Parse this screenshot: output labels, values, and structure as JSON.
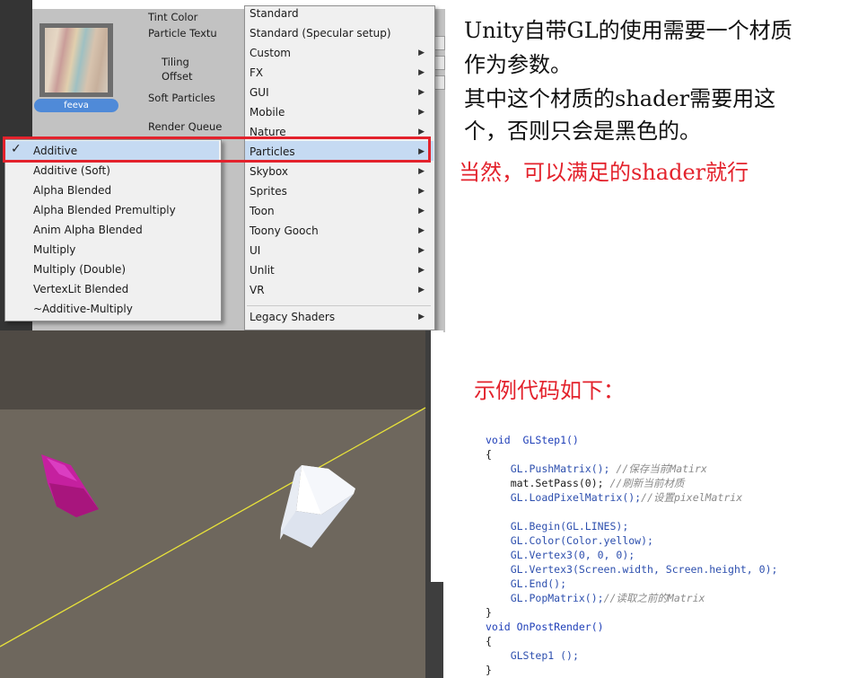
{
  "inspector": {
    "material_name": "feeva",
    "labels": {
      "tint_color": "Tint Color",
      "particle_texture": "Particle Textu",
      "tiling": "Tiling",
      "offset": "Offset",
      "soft_particles": "Soft Particles",
      "render_queue": "Render Queue"
    }
  },
  "shader_menu": {
    "items": [
      {
        "label": "Standard",
        "submenu": false
      },
      {
        "label": "Standard (Specular setup)",
        "submenu": false
      },
      {
        "label": "Custom",
        "submenu": true
      },
      {
        "label": "FX",
        "submenu": true
      },
      {
        "label": "GUI",
        "submenu": true
      },
      {
        "label": "Mobile",
        "submenu": true
      },
      {
        "label": "Nature",
        "submenu": true
      },
      {
        "label": "Particles",
        "submenu": true,
        "selected": true
      },
      {
        "label": "Skybox",
        "submenu": true
      },
      {
        "label": "Sprites",
        "submenu": true
      },
      {
        "label": "Toon",
        "submenu": true
      },
      {
        "label": "Toony Gooch",
        "submenu": true
      },
      {
        "label": "UI",
        "submenu": true
      },
      {
        "label": "Unlit",
        "submenu": true
      },
      {
        "label": "VR",
        "submenu": true
      },
      {
        "label": "Legacy Shaders",
        "submenu": true
      }
    ],
    "arrow_glyph": "▶"
  },
  "particles_submenu": {
    "check_glyph": "✓",
    "items": [
      {
        "label": "Additive",
        "checked": true
      },
      {
        "label": "Additive (Soft)"
      },
      {
        "label": "Alpha Blended"
      },
      {
        "label": "Alpha Blended Premultiply"
      },
      {
        "label": "Anim Alpha Blended"
      },
      {
        "label": "Multiply"
      },
      {
        "label": "Multiply (Double)"
      },
      {
        "label": "VertexLit Blended"
      },
      {
        "label": "~Additive-Multiply"
      }
    ]
  },
  "notes": {
    "line1": "Unity自带GL的使用需要一个材质",
    "line2": "作为参数。",
    "line3": "其中这个材质的shader需要用这",
    "line4": "个，否则只会是黑色的。",
    "red_note": "当然，可以满足的shader就行",
    "example_heading": "示例代码如下："
  },
  "code": {
    "sig1": "void  GLStep1()",
    "open1": "{",
    "push": "GL.PushMatrix();",
    "push_cm": "//保存当前Matirx",
    "setpass": "mat.SetPass(0);",
    "setpass_cm": "//刷新当前材质",
    "loadpix": "GL.LoadPixelMatrix();",
    "loadpix_cm": "//设置pixelMatrix",
    "begin": "GL.Begin(GL.LINES);",
    "color": "GL.Color(Color.yellow);",
    "v1": "GL.Vertex3(0, 0, 0);",
    "v2": "GL.Vertex3(Screen.width, Screen.height, 0);",
    "end": "GL.End();",
    "pop": "GL.PopMatrix();",
    "pop_cm": "//读取之前的Matrix",
    "close1": "}",
    "sig2": "void OnPostRender()",
    "open2": "{",
    "call": "GLStep1 ();",
    "close2": "}"
  },
  "colors": {
    "highlight_box": "#e3222c",
    "note_text": "#111111",
    "red_note_text": "#e3222c",
    "gl_line": "#e8e23a"
  }
}
